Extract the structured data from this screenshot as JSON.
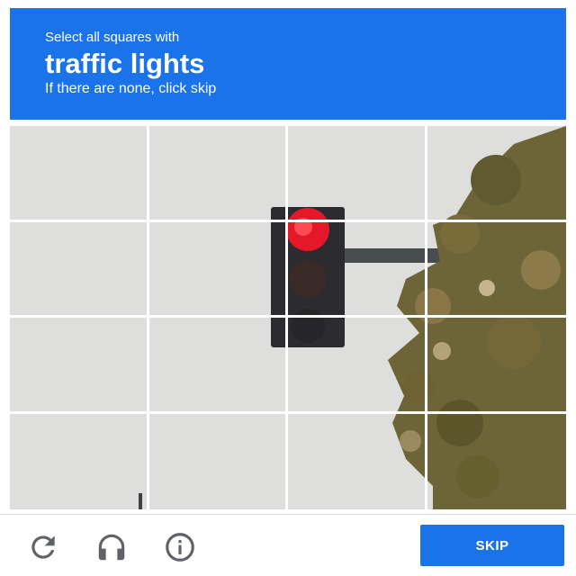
{
  "header": {
    "instruction": "Select all squares with",
    "target": "traffic lights",
    "hint": "If there are none, click skip"
  },
  "grid": {
    "rows": 4,
    "columns": 4,
    "image_subject": "traffic light"
  },
  "footer": {
    "reload_icon": "reload-icon",
    "audio_icon": "headphones-icon",
    "info_icon": "info-icon",
    "skip_label": "SKIP"
  },
  "colors": {
    "accent": "#1a73e8",
    "icon": "#5f6368"
  }
}
